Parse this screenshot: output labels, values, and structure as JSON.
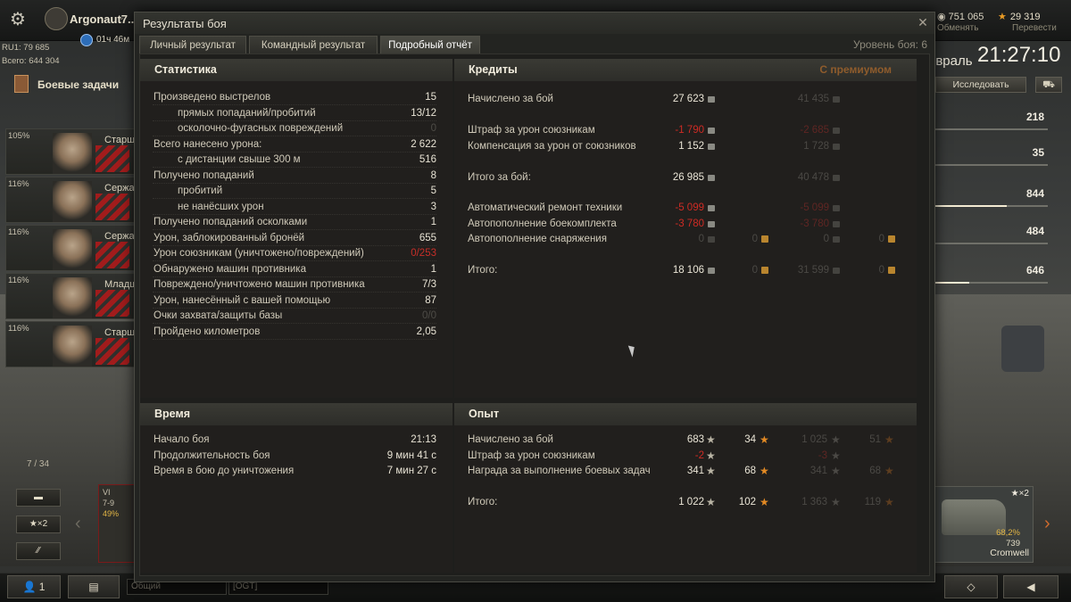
{
  "topbar": {
    "player_name": "Argonaut7..",
    "premium_time": "01ч 46м",
    "rating": "RU1: 79 685",
    "total": "Всего: 644 304",
    "credits": "751 065",
    "exchange_label": "Обменять",
    "gold": "29 319",
    "transfer_label": "Перевести",
    "date": "евраль",
    "clock": "21:27:10",
    "research_label": "Исследовать"
  },
  "right_stats": [
    "218",
    "35",
    "844",
    "484",
    "646"
  ],
  "left_panel": {
    "missions_label": "Боевые задачи",
    "crew": [
      {
        "pct": "105%",
        "rank": "Старши"
      },
      {
        "pct": "116%",
        "rank": "Сержан"
      },
      {
        "pct": "116%",
        "rank": "Сержан"
      },
      {
        "pct": "116%",
        "rank": "Младш"
      },
      {
        "pct": "116%",
        "rank": "Старши"
      }
    ],
    "slider_counter": "7 / 34"
  },
  "carousel": {
    "left_card": {
      "tier": "VI",
      "line2": "7-9",
      "pct": "49%"
    },
    "x2_label": "★×2",
    "right_card": {
      "x2": "★×2",
      "pct": "68,2%",
      "cost": "739",
      "name": "Cromwell"
    }
  },
  "bottom": {
    "contacts_count": "1",
    "chat_general": "Общий",
    "chat_ogt": "[OGT]"
  },
  "modal": {
    "title": "Результаты боя",
    "tabs": [
      "Личный результат",
      "Командный результат",
      "Подробный отчёт"
    ],
    "battle_level": "Уровень боя: 6"
  },
  "statistics": {
    "title": "Статистика",
    "rows": [
      {
        "label": "Произведено выстрелов",
        "value": "15"
      },
      {
        "label": "прямых попаданий/пробитий",
        "value": "13/12"
      },
      {
        "label": "осколочно-фугасных повреждений",
        "value": "0"
      },
      {
        "label": "Всего нанесено урона:",
        "value": "2 622"
      },
      {
        "label": "с дистанции свыше 300 м",
        "value": "516"
      },
      {
        "label": "Получено попаданий",
        "value": "8"
      },
      {
        "label": "пробитий",
        "value": "5"
      },
      {
        "label": "не нанёсших урон",
        "value": "3"
      },
      {
        "label": "Получено попаданий осколками",
        "value": "1"
      },
      {
        "label": "Урон, заблокированный бронёй",
        "value": "655"
      },
      {
        "label": "Урон союзникам (уничтожено/повреждений)",
        "value": "0/253"
      },
      {
        "label": "Обнаружено машин противника",
        "value": "1"
      },
      {
        "label": "Повреждено/уничтожено машин противника",
        "value": "7/3"
      },
      {
        "label": "Урон, нанесённый с вашей помощью",
        "value": "87"
      },
      {
        "label": "Очки захвата/защиты базы",
        "value": "0/0"
      },
      {
        "label": "Пройдено километров",
        "value": "2,05"
      }
    ]
  },
  "credits": {
    "title": "Кредиты",
    "premium_label": "С премиумом",
    "rows": [
      {
        "label": "Начислено за бой",
        "v1": "27 623",
        "p1": "41 435"
      },
      {
        "label": "Штраф за урон союзникам",
        "v1": "-1 790",
        "p1": "-2 685"
      },
      {
        "label": "Компенсация за урон от союзников",
        "v1": "1 152",
        "p1": "1 728"
      },
      {
        "label": "Итого за бой:",
        "v1": "26 985",
        "p1": "40 478"
      },
      {
        "label": "Автоматический ремонт техники",
        "v1": "-5 099",
        "p1": "-5 099"
      },
      {
        "label": "Автопополнение боекомплекта",
        "v1": "-3 780",
        "p1": "-3 780"
      },
      {
        "label": "Автопополнение снаряжения",
        "v1": "0",
        "g1": "0",
        "p1": "0",
        "pg1": "0"
      },
      {
        "label": "Итого:",
        "v1": "18 106",
        "g1": "0",
        "p1": "31 599",
        "pg1": "0"
      }
    ]
  },
  "time": {
    "title": "Время",
    "rows": [
      {
        "label": "Начало боя",
        "value": "21:13"
      },
      {
        "label": "Продолжительность боя",
        "value": "9 мин 41 с"
      },
      {
        "label": "Время в бою до уничтожения",
        "value": "7 мин 27 с"
      }
    ]
  },
  "experience": {
    "title": "Опыт",
    "rows": [
      {
        "label": "Начислено за бой",
        "v1": "683",
        "v2": "34",
        "p1": "1 025",
        "p2": "51"
      },
      {
        "label": "Штраф за урон союзникам",
        "v1": "-2",
        "v2": "",
        "p1": "-3",
        "p2": ""
      },
      {
        "label": "Награда за выполнение боевых задач",
        "v1": "341",
        "v2": "68",
        "p1": "341",
        "p2": "68"
      },
      {
        "label": "Итого:",
        "v1": "1 022",
        "v2": "102",
        "p1": "1 363",
        "p2": "119"
      }
    ]
  }
}
